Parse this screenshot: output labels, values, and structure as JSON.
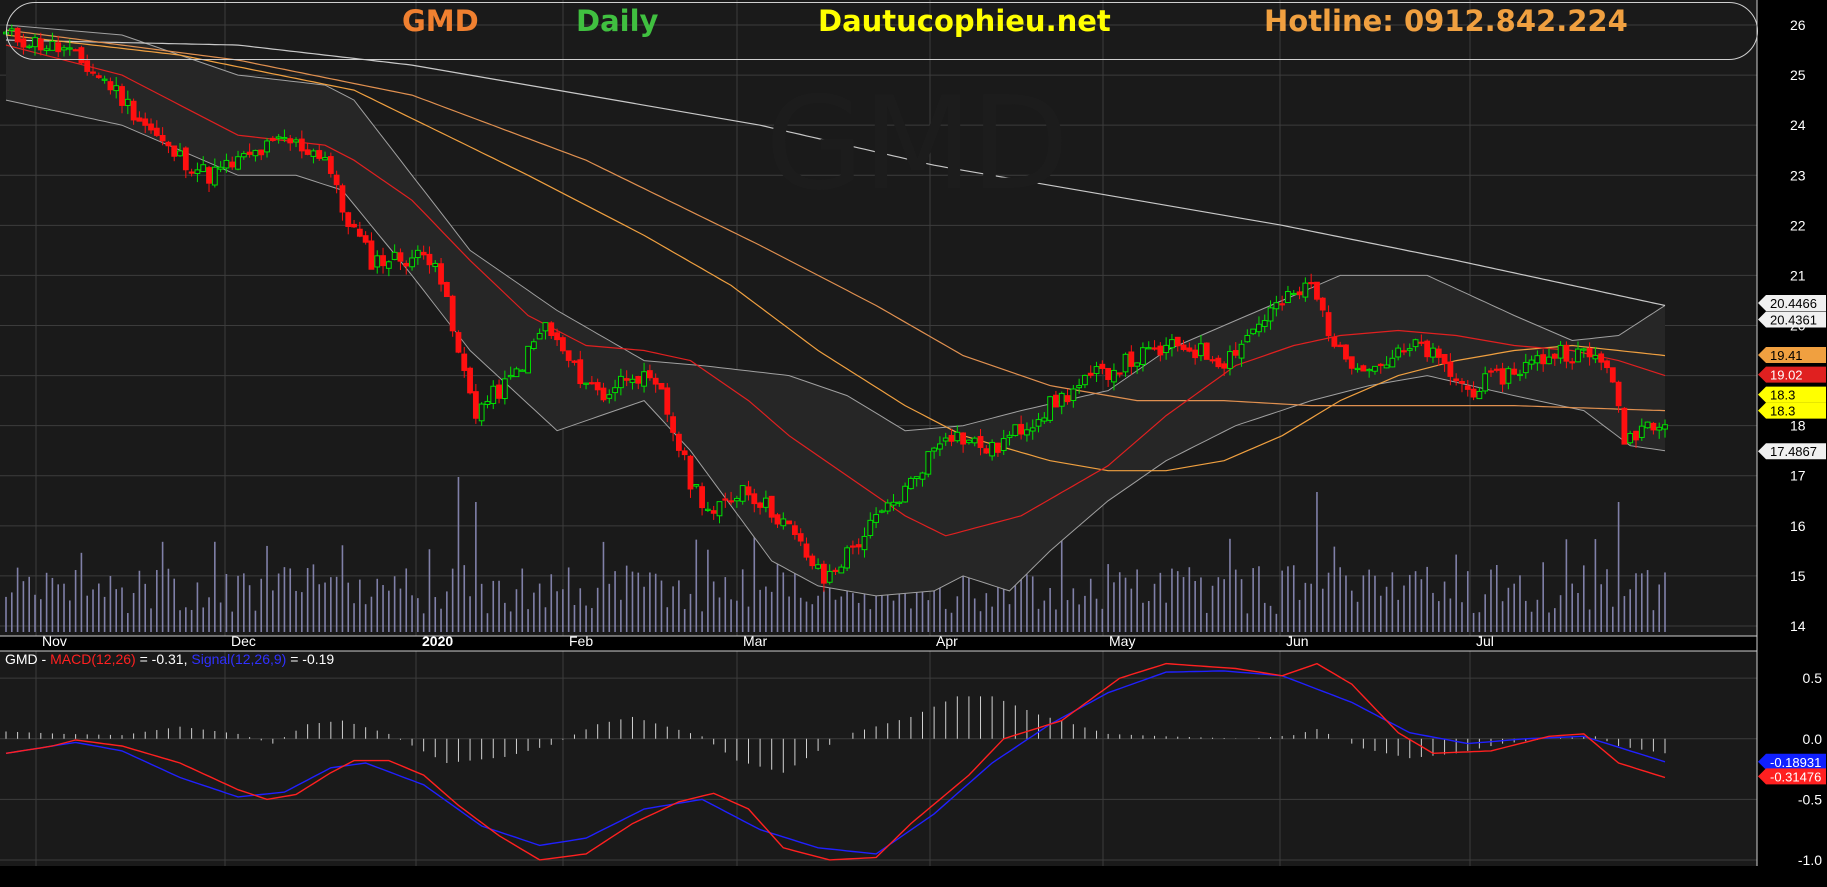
{
  "header": {
    "ticker": "GMD",
    "interval": "Daily",
    "site": "Dautucophieu.net",
    "hotline": "Hotline: 0912.842.224",
    "watermark": "GMD"
  },
  "colors": {
    "background": "#000000",
    "panel": "#1a1a1a",
    "grid": "#3c3c3c",
    "up_candle": "#00e000",
    "down_candle": "#ff1010",
    "volume": "#8080a8",
    "bollinger": "#a0a0a0",
    "ma_red": "#e02020",
    "ma_orange": "#f0a040",
    "ma_orange2": "#e09050",
    "ma_white": "#c8c8c8",
    "macd_line": "#ff2020",
    "signal_line": "#2020ff",
    "histogram": "#d0d0d0",
    "ticker_color": "#f08030",
    "interval_color": "#40c040",
    "site_color": "#ffff00",
    "hotline_color": "#f0a040"
  },
  "macd_legend": {
    "ticker": "GMD",
    "dash": " - ",
    "macd_label": "MACD(12,26)",
    "macd_value": " = -0.31, ",
    "signal_label": "Signal(12,26,9)",
    "signal_value": " = -0.19"
  },
  "chart_data": [
    {
      "type": "candlestick",
      "name": "price",
      "x_tick_labels": [
        "Nov",
        "Dec",
        "2020",
        "Feb",
        "Mar",
        "Apr",
        "May",
        "Jun",
        "Jul"
      ],
      "y_tick_labels": [
        "14",
        "15",
        "16",
        "17",
        "18",
        "19",
        "20",
        "21",
        "22",
        "23",
        "24",
        "25",
        "26"
      ],
      "ylim": [
        13.8,
        26.3
      ],
      "grid": true,
      "price_tags": [
        {
          "text": "20.4466",
          "value": 20.45,
          "bg": "#f0f0f0",
          "fg": "#000000"
        },
        {
          "text": "20.4361",
          "value": 20.44,
          "bg": "#f0f0f0",
          "fg": "#000000",
          "stack": 1
        },
        {
          "text": "19.41",
          "value": 19.41,
          "bg": "#f0a040",
          "fg": "#000000"
        },
        {
          "text": "19.02",
          "value": 19.02,
          "bg": "#e02020",
          "fg": "#ffffff"
        },
        {
          "text": "18.3",
          "value": 18.3,
          "bg": "#ffff00",
          "fg": "#000000",
          "stack": -1
        },
        {
          "text": "18.3",
          "value": 18.3,
          "bg": "#ffff00",
          "fg": "#000000"
        },
        {
          "text": "17.4867",
          "value": 17.49,
          "bg": "#f0f0f0",
          "fg": "#000000"
        }
      ],
      "anchors": [
        [
          0,
          25.8
        ],
        [
          10,
          25.5
        ],
        [
          18,
          24.8
        ],
        [
          28,
          23.5
        ],
        [
          35,
          23.0
        ],
        [
          48,
          23.7
        ],
        [
          55,
          23.4
        ],
        [
          58,
          22.3
        ],
        [
          63,
          21.3
        ],
        [
          74,
          21.4
        ],
        [
          78,
          19.4
        ],
        [
          81,
          18.3
        ],
        [
          87,
          18.9
        ],
        [
          93,
          20.0
        ],
        [
          98,
          19.1
        ],
        [
          103,
          18.6
        ],
        [
          108,
          19.1
        ],
        [
          113,
          18.6
        ],
        [
          118,
          16.9
        ],
        [
          122,
          16.2
        ],
        [
          127,
          16.8
        ],
        [
          134,
          16.1
        ],
        [
          141,
          14.9
        ],
        [
          150,
          16.1
        ],
        [
          155,
          16.7
        ],
        [
          162,
          17.9
        ],
        [
          170,
          17.5
        ],
        [
          180,
          18.4
        ],
        [
          188,
          19.0
        ],
        [
          196,
          19.4
        ],
        [
          203,
          19.6
        ],
        [
          210,
          19.3
        ],
        [
          218,
          20.3
        ],
        [
          225,
          20.8
        ],
        [
          230,
          19.4
        ],
        [
          236,
          19.2
        ],
        [
          244,
          19.6
        ],
        [
          252,
          18.7
        ],
        [
          260,
          19.1
        ],
        [
          268,
          19.5
        ],
        [
          276,
          19.3
        ],
        [
          279,
          17.7
        ],
        [
          282,
          18.0
        ],
        [
          286,
          18.2
        ]
      ],
      "bollinger_upper": [
        [
          0,
          26.0
        ],
        [
          20,
          25.8
        ],
        [
          40,
          25.0
        ],
        [
          55,
          24.8
        ],
        [
          60,
          24.5
        ],
        [
          70,
          23.0
        ],
        [
          80,
          21.5
        ],
        [
          95,
          20.3
        ],
        [
          110,
          19.3
        ],
        [
          120,
          19.2
        ],
        [
          135,
          19.0
        ],
        [
          145,
          18.6
        ],
        [
          155,
          17.9
        ],
        [
          165,
          18.0
        ],
        [
          175,
          18.3
        ],
        [
          190,
          18.7
        ],
        [
          200,
          19.5
        ],
        [
          212,
          20.1
        ],
        [
          222,
          20.6
        ],
        [
          230,
          21.0
        ],
        [
          245,
          21.0
        ],
        [
          260,
          20.2
        ],
        [
          270,
          19.7
        ],
        [
          278,
          19.8
        ],
        [
          286,
          20.4
        ]
      ],
      "bollinger_lower": [
        [
          0,
          24.5
        ],
        [
          20,
          24.0
        ],
        [
          40,
          23.0
        ],
        [
          50,
          23.0
        ],
        [
          58,
          22.7
        ],
        [
          70,
          21.0
        ],
        [
          80,
          19.5
        ],
        [
          95,
          17.9
        ],
        [
          110,
          18.5
        ],
        [
          118,
          17.5
        ],
        [
          132,
          15.3
        ],
        [
          140,
          14.8
        ],
        [
          150,
          14.6
        ],
        [
          160,
          14.7
        ],
        [
          165,
          15.0
        ],
        [
          173,
          14.7
        ],
        [
          180,
          15.5
        ],
        [
          190,
          16.5
        ],
        [
          200,
          17.3
        ],
        [
          212,
          18.0
        ],
        [
          225,
          18.5
        ],
        [
          235,
          18.8
        ],
        [
          245,
          19.0
        ],
        [
          260,
          18.6
        ],
        [
          272,
          18.3
        ],
        [
          280,
          17.6
        ],
        [
          286,
          17.5
        ]
      ],
      "ma_red": [
        [
          0,
          25.6
        ],
        [
          20,
          25.0
        ],
        [
          40,
          23.8
        ],
        [
          55,
          23.6
        ],
        [
          60,
          23.3
        ],
        [
          70,
          22.5
        ],
        [
          80,
          21.3
        ],
        [
          90,
          20.2
        ],
        [
          100,
          19.6
        ],
        [
          110,
          19.5
        ],
        [
          118,
          19.3
        ],
        [
          128,
          18.5
        ],
        [
          135,
          17.8
        ],
        [
          145,
          17.0
        ],
        [
          155,
          16.2
        ],
        [
          162,
          15.8
        ],
        [
          175,
          16.2
        ],
        [
          190,
          17.2
        ],
        [
          200,
          18.2
        ],
        [
          212,
          19.2
        ],
        [
          222,
          19.6
        ],
        [
          230,
          19.8
        ],
        [
          240,
          19.9
        ],
        [
          250,
          19.8
        ],
        [
          260,
          19.6
        ],
        [
          270,
          19.5
        ],
        [
          278,
          19.3
        ],
        [
          286,
          19.0
        ]
      ],
      "ma_orange": [
        [
          0,
          25.8
        ],
        [
          30,
          25.4
        ],
        [
          60,
          24.7
        ],
        [
          90,
          23.0
        ],
        [
          110,
          21.8
        ],
        [
          125,
          20.8
        ],
        [
          140,
          19.5
        ],
        [
          155,
          18.4
        ],
        [
          165,
          17.8
        ],
        [
          180,
          17.3
        ],
        [
          190,
          17.1
        ],
        [
          200,
          17.1
        ],
        [
          210,
          17.3
        ],
        [
          220,
          17.8
        ],
        [
          230,
          18.5
        ],
        [
          240,
          19.0
        ],
        [
          250,
          19.3
        ],
        [
          260,
          19.5
        ],
        [
          270,
          19.6
        ],
        [
          286,
          19.4
        ]
      ],
      "ma_orange2": [
        [
          0,
          25.9
        ],
        [
          40,
          25.3
        ],
        [
          70,
          24.6
        ],
        [
          100,
          23.3
        ],
        [
          130,
          21.6
        ],
        [
          150,
          20.4
        ],
        [
          165,
          19.4
        ],
        [
          180,
          18.8
        ],
        [
          195,
          18.5
        ],
        [
          210,
          18.5
        ],
        [
          225,
          18.4
        ],
        [
          240,
          18.4
        ],
        [
          260,
          18.4
        ],
        [
          286,
          18.3
        ]
      ],
      "ma_white": [
        [
          0,
          25.7
        ],
        [
          40,
          25.6
        ],
        [
          70,
          25.2
        ],
        [
          100,
          24.6
        ],
        [
          130,
          24.0
        ],
        [
          160,
          23.2
        ],
        [
          190,
          22.6
        ],
        [
          220,
          22.0
        ],
        [
          250,
          21.3
        ],
        [
          270,
          20.8
        ],
        [
          286,
          20.4
        ]
      ]
    },
    {
      "type": "line",
      "name": "macd",
      "y_tick_labels": [
        "0.5",
        "0.0",
        "-0.5",
        "-1.0"
      ],
      "ylim": [
        -1.05,
        0.65
      ],
      "price_tags": [
        {
          "text": "-0.18931",
          "value": -0.19,
          "bg": "#1020ff",
          "fg": "#ffffff"
        },
        {
          "text": "-0.31476",
          "value": -0.31,
          "bg": "#ff2020",
          "fg": "#ffffff"
        }
      ],
      "series": [
        {
          "name": "MACD(12,26)",
          "anchors": [
            [
              0,
              -0.12
            ],
            [
              8,
              -0.06
            ],
            [
              12,
              -0.01
            ],
            [
              20,
              -0.06
            ],
            [
              30,
              -0.2
            ],
            [
              40,
              -0.42
            ],
            [
              45,
              -0.5
            ],
            [
              50,
              -0.46
            ],
            [
              56,
              -0.28
            ],
            [
              60,
              -0.18
            ],
            [
              66,
              -0.18
            ],
            [
              72,
              -0.3
            ],
            [
              78,
              -0.55
            ],
            [
              85,
              -0.8
            ],
            [
              92,
              -1.0
            ],
            [
              100,
              -0.95
            ],
            [
              108,
              -0.7
            ],
            [
              116,
              -0.52
            ],
            [
              122,
              -0.45
            ],
            [
              128,
              -0.58
            ],
            [
              134,
              -0.9
            ],
            [
              142,
              -1.0
            ],
            [
              150,
              -0.98
            ],
            [
              156,
              -0.7
            ],
            [
              166,
              -0.3
            ],
            [
              172,
              0.0
            ],
            [
              182,
              0.15
            ],
            [
              192,
              0.5
            ],
            [
              200,
              0.62
            ],
            [
              212,
              0.58
            ],
            [
              220,
              0.52
            ],
            [
              226,
              0.62
            ],
            [
              232,
              0.45
            ],
            [
              240,
              0.05
            ],
            [
              246,
              -0.12
            ],
            [
              256,
              -0.1
            ],
            [
              266,
              0.02
            ],
            [
              272,
              0.04
            ],
            [
              278,
              -0.2
            ],
            [
              286,
              -0.32
            ]
          ]
        },
        {
          "name": "Signal(12,26,9)",
          "anchors": [
            [
              0,
              -0.12
            ],
            [
              12,
              -0.03
            ],
            [
              20,
              -0.1
            ],
            [
              30,
              -0.32
            ],
            [
              40,
              -0.48
            ],
            [
              48,
              -0.44
            ],
            [
              56,
              -0.24
            ],
            [
              62,
              -0.2
            ],
            [
              72,
              -0.38
            ],
            [
              82,
              -0.72
            ],
            [
              92,
              -0.88
            ],
            [
              100,
              -0.82
            ],
            [
              110,
              -0.58
            ],
            [
              120,
              -0.5
            ],
            [
              130,
              -0.75
            ],
            [
              140,
              -0.9
            ],
            [
              150,
              -0.95
            ],
            [
              160,
              -0.62
            ],
            [
              170,
              -0.2
            ],
            [
              180,
              0.12
            ],
            [
              190,
              0.38
            ],
            [
              200,
              0.55
            ],
            [
              210,
              0.56
            ],
            [
              220,
              0.52
            ],
            [
              232,
              0.3
            ],
            [
              242,
              0.05
            ],
            [
              252,
              -0.04
            ],
            [
              262,
              0.0
            ],
            [
              272,
              0.02
            ],
            [
              280,
              -0.1
            ],
            [
              286,
              -0.19
            ]
          ]
        },
        {
          "name": "histogram",
          "type": "bar",
          "anchors": [
            [
              0,
              0.06
            ],
            [
              10,
              0.04
            ],
            [
              20,
              0.03
            ],
            [
              30,
              0.1
            ],
            [
              40,
              0.04
            ],
            [
              46,
              -0.04
            ],
            [
              52,
              0.12
            ],
            [
              58,
              0.15
            ],
            [
              66,
              0.04
            ],
            [
              76,
              -0.2
            ],
            [
              86,
              -0.15
            ],
            [
              94,
              -0.05
            ],
            [
              102,
              0.12
            ],
            [
              108,
              0.18
            ],
            [
              114,
              0.1
            ],
            [
              120,
              0.02
            ],
            [
              126,
              -0.18
            ],
            [
              134,
              -0.28
            ],
            [
              140,
              -0.1
            ],
            [
              146,
              0.05
            ],
            [
              156,
              0.18
            ],
            [
              164,
              0.35
            ],
            [
              170,
              0.35
            ],
            [
              178,
              0.2
            ],
            [
              184,
              0.12
            ],
            [
              190,
              0.04
            ],
            [
              200,
              0.02
            ],
            [
              214,
              0.0
            ],
            [
              222,
              0.03
            ],
            [
              226,
              0.08
            ],
            [
              234,
              -0.08
            ],
            [
              242,
              -0.16
            ],
            [
              250,
              -0.12
            ],
            [
              258,
              -0.04
            ],
            [
              266,
              0.0
            ],
            [
              274,
              0.02
            ],
            [
              278,
              -0.06
            ],
            [
              286,
              -0.12
            ]
          ]
        }
      ]
    }
  ]
}
